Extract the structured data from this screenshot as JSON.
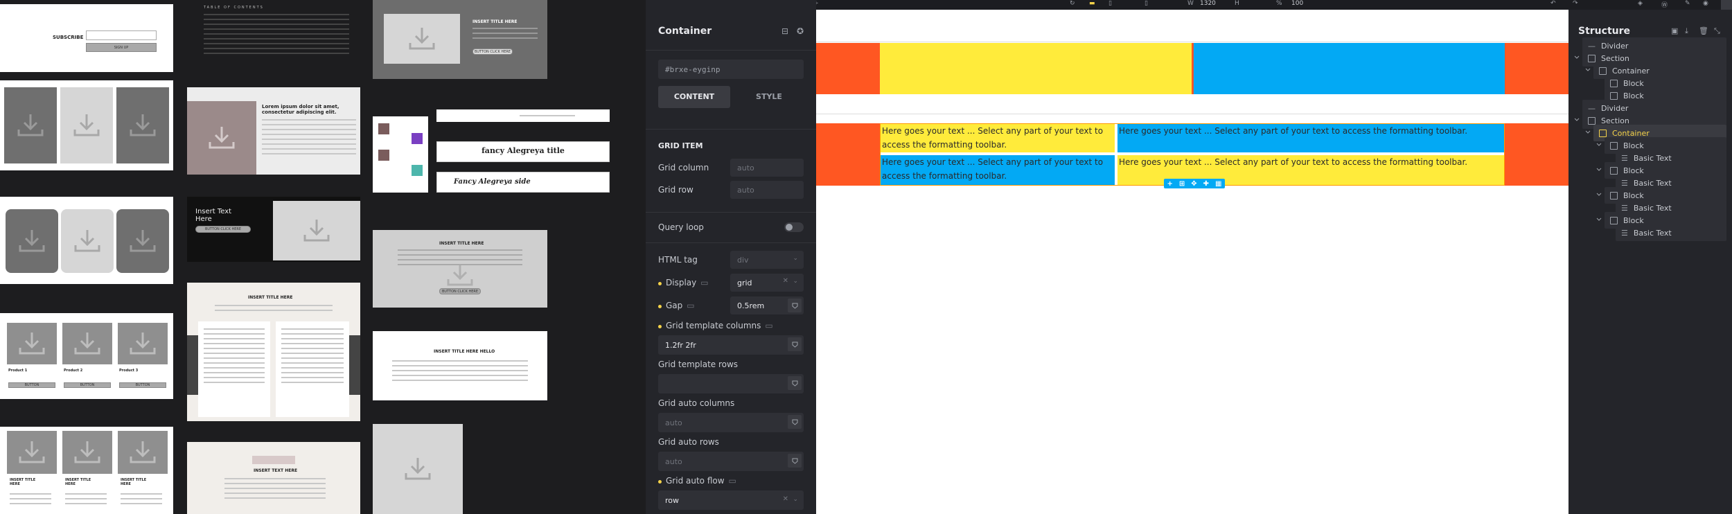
{
  "gallery": {
    "subscribe_title": "SUBSCRIBE",
    "subscribe_button": "SIGN UP",
    "toc_title": "TABLE OF CONTENTS",
    "lorem_heading": "Lorem ipsum dolor sit amet, consectetur adipiscing elit.",
    "insert_text_here": "Insert Text Here",
    "insert_title_here": "INSERT TITLE HERE",
    "insert_title_here_hello": "INSERT TITLE HERE HELLO",
    "insert_text_here_upper": "INSERT TEXT HERE",
    "fancy_title": "fancy Alegreya title",
    "fancy_side": "Fancy Alegreya side",
    "product_1": "Product 1",
    "product_2": "Product 2",
    "product_3": "Product 3",
    "button_label": "BUTTON",
    "button_click": "BUTTON CLICK HERE",
    "insert_title_here_short": "INSERT TITLE HERE"
  },
  "topbar": {
    "width_label": "W",
    "width_value": "1320",
    "height_label": "H",
    "percent_label": "%",
    "zoom_value": "100"
  },
  "panel": {
    "title": "Container",
    "css_id": "#brxe-eyginp",
    "tab_content": "CONTENT",
    "tab_style": "STYLE",
    "section_grid_item": "GRID ITEM",
    "grid_column_label": "Grid column",
    "grid_column_placeholder": "auto",
    "grid_row_label": "Grid row",
    "grid_row_placeholder": "auto",
    "query_loop_label": "Query loop",
    "html_tag_label": "HTML tag",
    "html_tag_value": "div",
    "display_label": "Display",
    "display_value": "grid",
    "gap_label": "Gap",
    "gap_value": "0.5rem",
    "grid_template_columns_label": "Grid template columns",
    "grid_template_columns_value": "1.2fr 2fr",
    "grid_template_rows_label": "Grid template rows",
    "grid_auto_columns_label": "Grid auto columns",
    "grid_auto_columns_placeholder": "auto",
    "grid_auto_rows_label": "Grid auto rows",
    "grid_auto_rows_placeholder": "auto",
    "grid_auto_flow_label": "Grid auto flow",
    "grid_auto_flow_value": "row"
  },
  "canvas": {
    "text_1": "Here goes your text ... Select any part of your text to access the formatting toolbar.",
    "text_2": "Here goes your text ... Select any part of your text to access the formatting toolbar.",
    "text_3": "Here goes your text ... Select any part of your text to access the formatting toolbar.",
    "text_4": "Here goes your text ... Select any part of your text to access the formatting toolbar.",
    "colors": {
      "orange": "#ff5722",
      "yellow": "#ffeb3b",
      "blue": "#03a9f4"
    }
  },
  "structure": {
    "title": "Structure",
    "items": [
      {
        "label": "Divider"
      },
      {
        "label": "Section"
      },
      {
        "label": "Container"
      },
      {
        "label": "Block"
      },
      {
        "label": "Block"
      },
      {
        "label": "Divider"
      },
      {
        "label": "Section"
      },
      {
        "label": "Container"
      },
      {
        "label": "Block"
      },
      {
        "label": "Basic Text"
      },
      {
        "label": "Block"
      },
      {
        "label": "Basic Text"
      },
      {
        "label": "Block"
      },
      {
        "label": "Basic Text"
      },
      {
        "label": "Block"
      },
      {
        "label": "Basic Text"
      }
    ]
  }
}
